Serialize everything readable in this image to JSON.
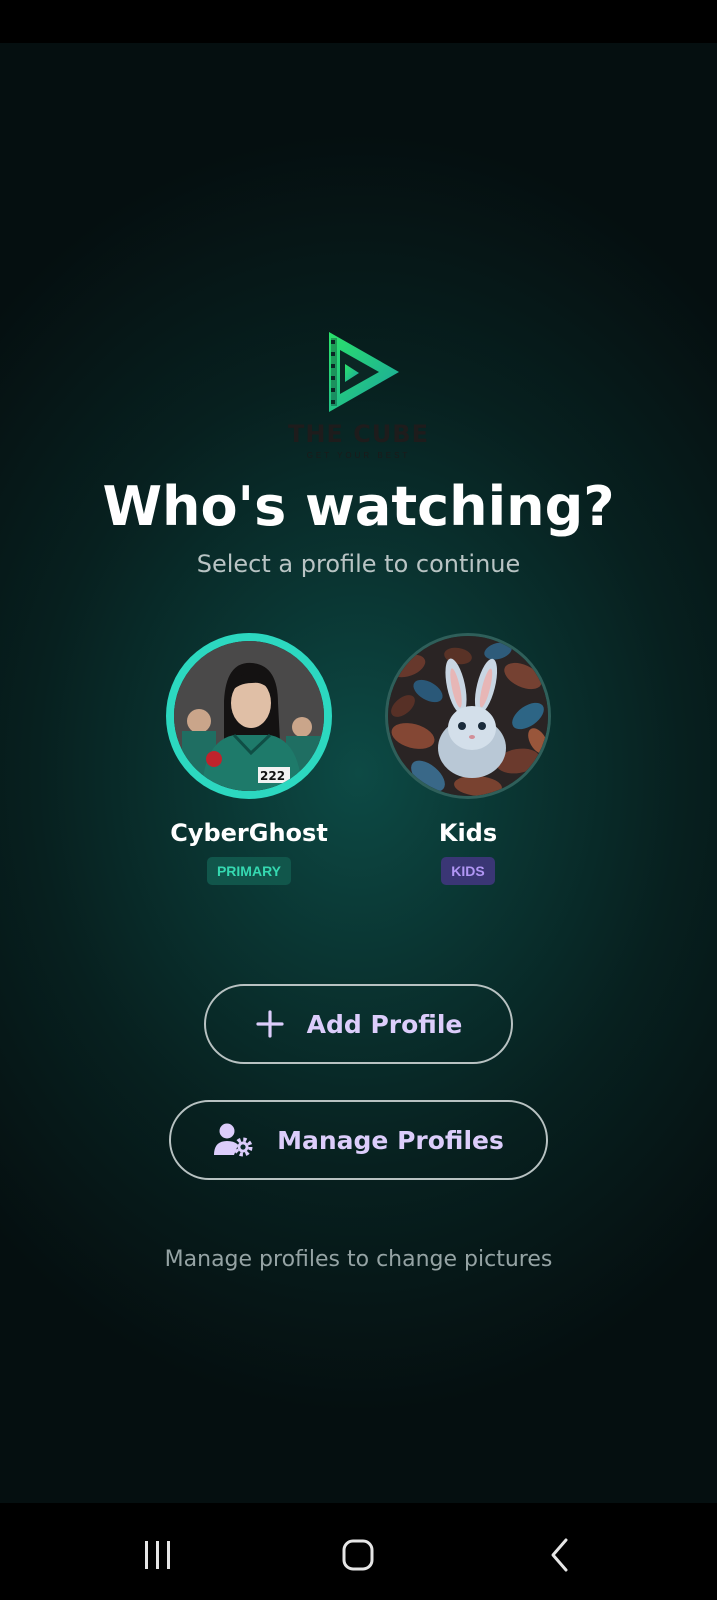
{
  "app": {
    "logo_name": "THE CUBE",
    "logo_tagline": "GET YOUR BEST",
    "title": "Who's watching?",
    "subtitle": "Select a profile to continue"
  },
  "profiles": [
    {
      "name": "CyberGhost",
      "badge": "PRIMARY",
      "selected": true
    },
    {
      "name": "Kids",
      "badge": "KIDS",
      "selected": false
    }
  ],
  "actions": {
    "add_profile": "Add Profile",
    "manage_profiles": "Manage Profiles"
  },
  "hint": "Manage profiles to change pictures",
  "icons": {
    "add": "plus-icon",
    "manage": "user-gear-icon",
    "nav_recents": "recents-icon",
    "nav_home": "home-icon",
    "nav_back": "back-icon"
  },
  "colors": {
    "accent": "#2cd8c0",
    "primary_badge_bg": "#11564b",
    "primary_badge_text": "#35d9b1",
    "kids_badge_bg": "#3a3675",
    "kids_badge_text": "#b196f5",
    "button_text": "#dccdfb"
  }
}
